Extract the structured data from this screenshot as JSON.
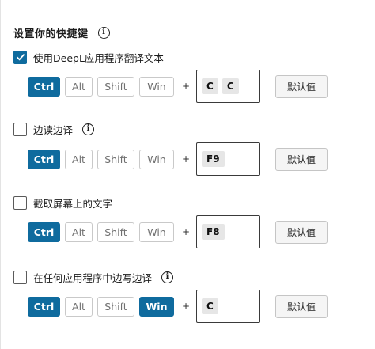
{
  "title": "设置你的快捷键",
  "plus_sign": "+",
  "shortcuts": [
    {
      "label": "使用DeepL应用程序翻译文本",
      "checked": true,
      "has_info": false,
      "modifiers": {
        "ctrl": "Ctrl",
        "alt": "Alt",
        "shift": "Shift",
        "win": "Win"
      },
      "active": [
        "ctrl"
      ],
      "keys": [
        "C",
        "C"
      ],
      "default_label": "默认值"
    },
    {
      "label": "边读边译",
      "checked": false,
      "has_info": true,
      "modifiers": {
        "ctrl": "Ctrl",
        "alt": "Alt",
        "shift": "Shift",
        "win": "Win"
      },
      "active": [
        "ctrl"
      ],
      "keys": [
        "F9"
      ],
      "default_label": "默认值"
    },
    {
      "label": "截取屏幕上的文字",
      "checked": false,
      "has_info": false,
      "modifiers": {
        "ctrl": "Ctrl",
        "alt": "Alt",
        "shift": "Shift",
        "win": "Win"
      },
      "active": [
        "ctrl"
      ],
      "keys": [
        "F8"
      ],
      "default_label": "默认值"
    },
    {
      "label": "在任何应用程序中边写边译",
      "checked": false,
      "has_info": true,
      "modifiers": {
        "ctrl": "Ctrl",
        "alt": "Alt",
        "shift": "Shift",
        "win": "Win"
      },
      "active": [
        "ctrl",
        "win"
      ],
      "keys": [
        "C"
      ],
      "default_label": "默认值"
    }
  ],
  "colors": {
    "accent": "#0f6b9e"
  },
  "icons": {
    "info": "info-circle-icon",
    "check": "checkmark-icon"
  }
}
